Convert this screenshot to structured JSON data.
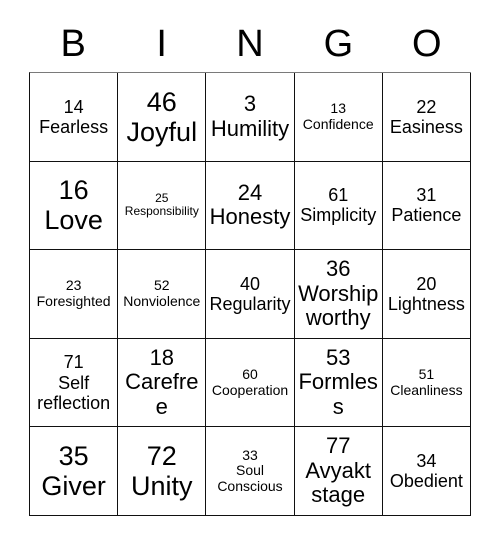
{
  "card": {
    "header": {
      "letters": [
        "B",
        "I",
        "N",
        "G",
        "O"
      ]
    },
    "rows": [
      [
        {
          "number": "14",
          "label": "Fearless",
          "size": "md"
        },
        {
          "number": "46",
          "label": "Joyful",
          "size": "xl"
        },
        {
          "number": "3",
          "label": "Humility",
          "size": "lg"
        },
        {
          "number": "13",
          "label": "Confidence",
          "size": "sm"
        },
        {
          "number": "22",
          "label": "Easiness",
          "size": "md"
        }
      ],
      [
        {
          "number": "16",
          "label": "Love",
          "size": "xl"
        },
        {
          "number": "25",
          "label": "Responsibility",
          "size": "xs"
        },
        {
          "number": "24",
          "label": "Honesty",
          "size": "lg"
        },
        {
          "number": "61",
          "label": "Simplicity",
          "size": "md"
        },
        {
          "number": "31",
          "label": "Patience",
          "size": "md"
        }
      ],
      [
        {
          "number": "23",
          "label": "Foresighted",
          "size": "sm"
        },
        {
          "number": "52",
          "label": "Nonviolence",
          "size": "sm"
        },
        {
          "number": "40",
          "label": "Regularity",
          "size": "md"
        },
        {
          "number": "36",
          "label": "Worship worthy",
          "size": "lg"
        },
        {
          "number": "20",
          "label": "Lightness",
          "size": "md"
        }
      ],
      [
        {
          "number": "71",
          "label": "Self reflection",
          "size": "md"
        },
        {
          "number": "18",
          "label": "Carefree",
          "size": "lg"
        },
        {
          "number": "60",
          "label": "Cooperation",
          "size": "sm"
        },
        {
          "number": "53",
          "label": "Formless",
          "size": "lg"
        },
        {
          "number": "51",
          "label": "Cleanliness",
          "size": "sm"
        }
      ],
      [
        {
          "number": "35",
          "label": "Giver",
          "size": "xl"
        },
        {
          "number": "72",
          "label": "Unity",
          "size": "xl"
        },
        {
          "number": "33",
          "label": "Soul Conscious",
          "size": "sm"
        },
        {
          "number": "77",
          "label": "Avyakt stage",
          "size": "lg"
        },
        {
          "number": "34",
          "label": "Obedient",
          "size": "md"
        }
      ]
    ]
  }
}
